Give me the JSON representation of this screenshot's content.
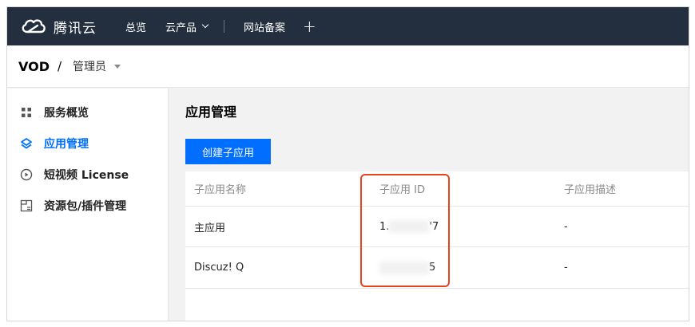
{
  "topnav": {
    "brand": "腾讯云",
    "items": [
      "总览",
      "云产品",
      "网站备案"
    ],
    "plus": "+",
    "bg_color": "#232f3e"
  },
  "breadcrumb": {
    "product": "VOD",
    "separator": "/",
    "role": "管理员"
  },
  "sidebar": {
    "items": [
      {
        "label": "服务概览",
        "icon": "grid-icon",
        "active": false
      },
      {
        "label": "应用管理",
        "icon": "layers-icon",
        "active": true
      },
      {
        "label": "短视频 License",
        "icon": "play-circle-icon",
        "active": false
      },
      {
        "label": "资源包/插件管理",
        "icon": "package-icon",
        "active": false
      }
    ]
  },
  "main": {
    "title": "应用管理",
    "create_button": "创建子应用",
    "table": {
      "headers": [
        "子应用名称",
        "子应用 ID",
        "子应用描述"
      ],
      "rows": [
        {
          "name": "主应用",
          "id_visible_start": "1.",
          "id_visible_end": "'7",
          "desc": "-"
        },
        {
          "name": "Discuz! Q",
          "id_visible_start": "",
          "id_visible_end": "5",
          "desc": "-"
        }
      ]
    }
  },
  "colors": {
    "accent": "#006eff",
    "highlight": "#e8431a"
  }
}
